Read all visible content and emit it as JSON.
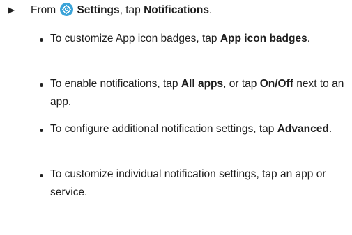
{
  "step": {
    "prefix": "From",
    "settings_label": "Settings",
    "middle": ", tap ",
    "target": "Notifications",
    "suffix": "."
  },
  "bullets": [
    {
      "pre": "To customize App icon badges, tap ",
      "bold": "App icon badges",
      "post": "."
    },
    {
      "pre": "To enable notifications, tap ",
      "bold": "All apps",
      "mid": ", or tap ",
      "bold2": "On/Off",
      "post": " next to an app."
    },
    {
      "pre": "To configure additional notification settings, tap ",
      "bold": "Advanced",
      "post": "."
    },
    {
      "pre": "To customize individual notification settings, tap an app or service."
    }
  ],
  "icons": {
    "step_marker": "triangle-right-icon",
    "settings": "gear-icon",
    "settings_color": "#3aa3d8"
  }
}
